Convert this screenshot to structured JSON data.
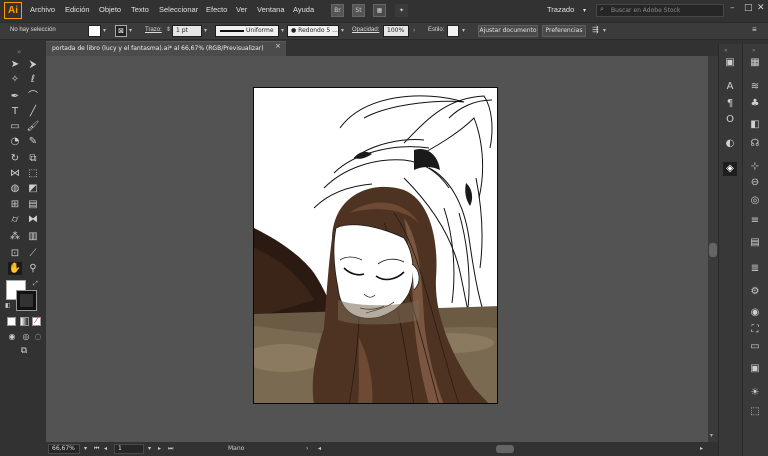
{
  "menu": {
    "logo": "Ai",
    "items": [
      "Archivo",
      "Edición",
      "Objeto",
      "Texto",
      "Seleccionar",
      "Efecto",
      "Ver",
      "Ventana",
      "Ayuda"
    ],
    "bridge_label": "Br",
    "stock_label": "St",
    "workspace": "Trazado",
    "search_placeholder": "Buscar en Adobe Stock"
  },
  "control": {
    "selection_status": "No hay selección",
    "stroke_label": "Trazo:",
    "stroke_weight": "1 pt",
    "profile": "Uniforme",
    "brush": "Redondo 5 ...",
    "opacity_label": "Opacidad:",
    "opacity_value": "100%",
    "style_label": "Estilo:",
    "doc_setup": "Ajustar documento",
    "preferences": "Preferencias"
  },
  "document": {
    "tab_title": "portada de libro (lucy y el fantasma).ai* al 66,67% (RGB/Previsualizar)",
    "close": "×"
  },
  "status": {
    "zoom": "66,67%",
    "artboard_number": "1",
    "tool_name": "Mano"
  },
  "icons": {
    "tools": [
      "selection-icon",
      "direct-selection-icon",
      "magic-wand-icon",
      "lasso-icon",
      "pen-icon",
      "curvature-icon",
      "type-icon",
      "line-icon",
      "rectangle-icon",
      "paintbrush-icon",
      "shaper-icon",
      "pencil-icon",
      "eraser-icon",
      "rotate-icon",
      "scale-icon",
      "width-icon",
      "free-transform-icon",
      "shape-builder-icon",
      "perspective-icon",
      "mesh-icon",
      "gradient-icon",
      "eyedropper-icon",
      "blend-icon",
      "symbol-sprayer-icon",
      "column-graph-icon",
      "artboard-icon",
      "slice-icon",
      "hand-icon",
      "zoom-icon"
    ],
    "dock_left": [
      "libraries-icon",
      "character-icon",
      "paragraph-icon",
      "opentype-icon",
      "color-guide-icon",
      "transparency-icon",
      "appearance-icon",
      "layers-icon"
    ],
    "dock_right": [
      "swatches-icon",
      "brushes-icon",
      "symbols-icon",
      "graphic-styles-icon",
      "links-icon",
      "transform-icon",
      "align-icon",
      "pathfinder-icon",
      "stroke-icon",
      "gradient-panel-icon",
      "color-icon",
      "info-icon",
      "navigator-icon",
      "properties-icon",
      "export-icon",
      "artboards-panel-icon"
    ]
  },
  "colors": {
    "accent": "#ff9a00",
    "hair": "#4e3323",
    "sea": "#7a6a52",
    "background": "#323232"
  }
}
